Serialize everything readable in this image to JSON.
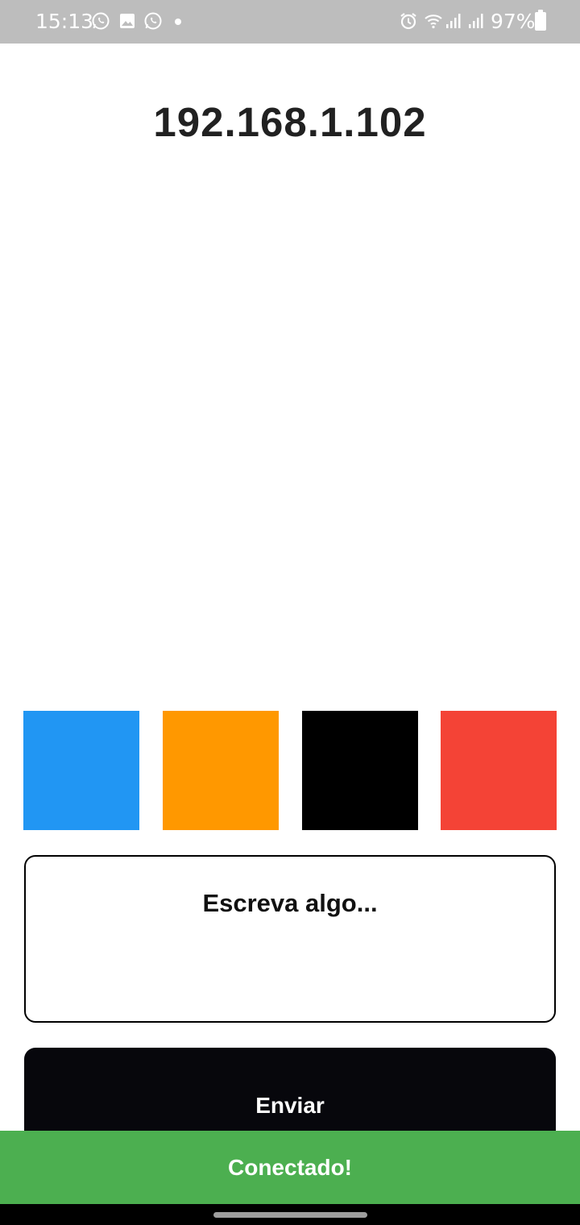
{
  "status_bar": {
    "time": "15:13",
    "icons": [
      "whatsapp-icon",
      "gallery-icon",
      "whatsapp-icon",
      "alarm-icon",
      "wifi-icon",
      "signal-icon",
      "signal-icon",
      "battery-icon"
    ],
    "battery_percent": "97%"
  },
  "header": {
    "ip_address": "192.168.1.102"
  },
  "colors": {
    "swatches": [
      {
        "name": "blue",
        "hex": "#2196F3"
      },
      {
        "name": "orange",
        "hex": "#FF9800"
      },
      {
        "name": "black",
        "hex": "#000000"
      },
      {
        "name": "red",
        "hex": "#F44336"
      }
    ]
  },
  "message": {
    "placeholder": "Escreva algo...",
    "value": ""
  },
  "send_button": {
    "label": "Enviar"
  },
  "snackbar": {
    "text": "Conectado!",
    "color": "#4CAF50"
  }
}
